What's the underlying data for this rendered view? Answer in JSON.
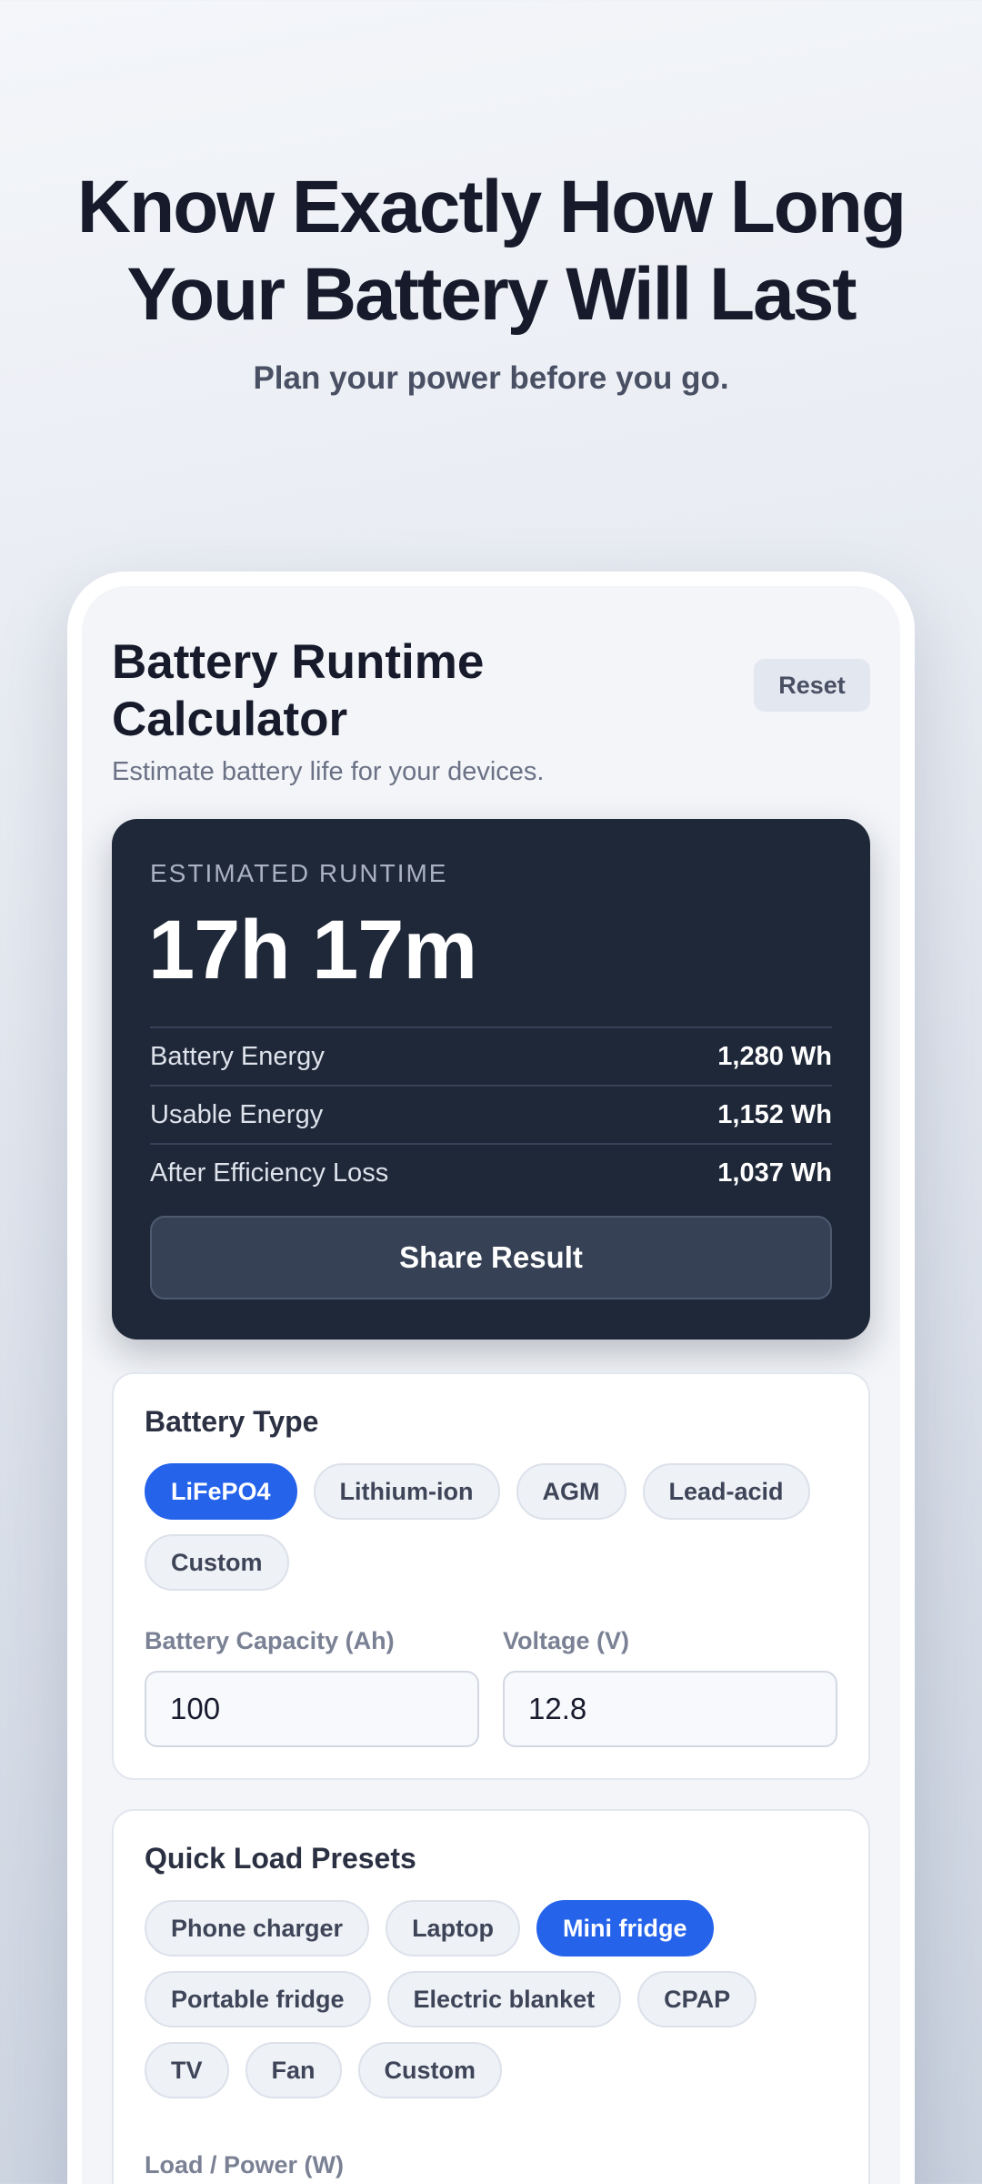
{
  "hero": {
    "title_line1": "Know Exactly How Long",
    "title_line2": "Your Battery Will Last",
    "subtitle": "Plan your power before you go."
  },
  "card": {
    "title": "Battery Runtime Calculator",
    "subtitle": "Estimate battery life for your devices.",
    "reset_label": "Reset"
  },
  "result": {
    "label": "ESTIMATED RUNTIME",
    "value": "17h 17m",
    "stats": [
      {
        "label": "Battery Energy",
        "value": "1,280 Wh"
      },
      {
        "label": "Usable Energy",
        "value": "1,152 Wh"
      },
      {
        "label": "After Efficiency Loss",
        "value": "1,037 Wh"
      }
    ],
    "share_label": "Share Result"
  },
  "battery": {
    "title": "Battery Type",
    "types": [
      "LiFePO4",
      "Lithium-ion",
      "AGM",
      "Lead-acid",
      "Custom"
    ],
    "selected_type": "LiFePO4",
    "capacity_label": "Battery Capacity (Ah)",
    "capacity_value": "100",
    "voltage_label": "Voltage (V)",
    "voltage_value": "12.8"
  },
  "presets": {
    "title": "Quick Load Presets",
    "items": [
      "Phone charger",
      "Laptop",
      "Mini fridge",
      "Portable fridge",
      "Electric blanket",
      "CPAP",
      "TV",
      "Fan",
      "Custom"
    ],
    "selected": "Mini fridge",
    "load_label": "Load / Power (W)"
  },
  "colors": {
    "accent": "#2563eb",
    "result_bg": "#1f2839"
  }
}
